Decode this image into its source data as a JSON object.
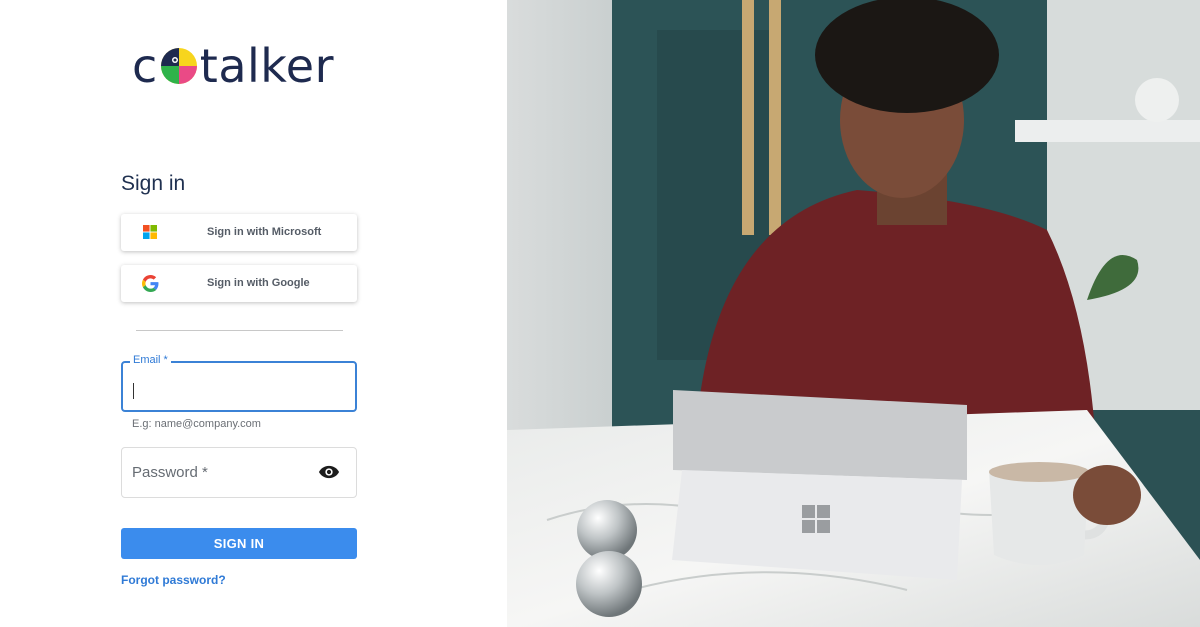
{
  "brand": {
    "logo_c": "c",
    "logo_rest": "talker"
  },
  "signin": {
    "title": "Sign in",
    "microsoft_label": "Sign in with Microsoft",
    "google_label": "Sign in with Google",
    "email_label": "Email *",
    "email_helper": "E.g: name@company.com",
    "email_value": "",
    "password_placeholder": "Password *",
    "submit_label": "SIGN IN",
    "forgot_label": "Forgot password?"
  },
  "colors": {
    "brand_navy": "#1e2a4f",
    "accent_blue": "#3b8ced",
    "link_blue": "#2f7ad6"
  },
  "icons": {
    "microsoft": "microsoft-logo-icon",
    "google": "google-logo-icon",
    "password_toggle": "eye-icon"
  }
}
